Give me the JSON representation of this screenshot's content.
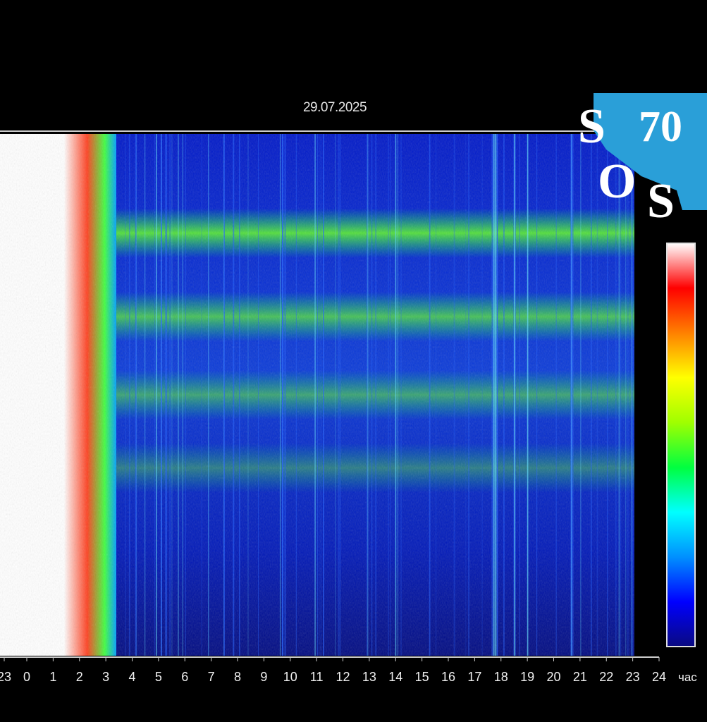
{
  "chart_data": {
    "type": "heatmap",
    "title": "29.07.2025",
    "xlabel": "час",
    "x_ticks": [
      "23",
      "0",
      "1",
      "2",
      "3",
      "4",
      "5",
      "6",
      "7",
      "8",
      "9",
      "10",
      "11",
      "12",
      "13",
      "14",
      "15",
      "16",
      "17",
      "18",
      "19",
      "20",
      "21",
      "22",
      "23",
      "24"
    ],
    "x_range_hours": [
      0,
      24
    ],
    "bands_relative_frequency_position": [
      0.19,
      0.35,
      0.5,
      0.64
    ],
    "saturation_end_hour": 3.1,
    "colorbar": [
      "#0a0a80",
      "#0000ff",
      "#0090ff",
      "#00ffff",
      "#00ff40",
      "#a0ff00",
      "#ffff00",
      "#ff8000",
      "#ff0000",
      "#ffffff"
    ],
    "colormap_low": "#000064",
    "colormap_high": "#ffffff"
  },
  "logo": {
    "text": [
      "S",
      "70",
      "O",
      "S"
    ],
    "color": "#2a9fd8"
  }
}
